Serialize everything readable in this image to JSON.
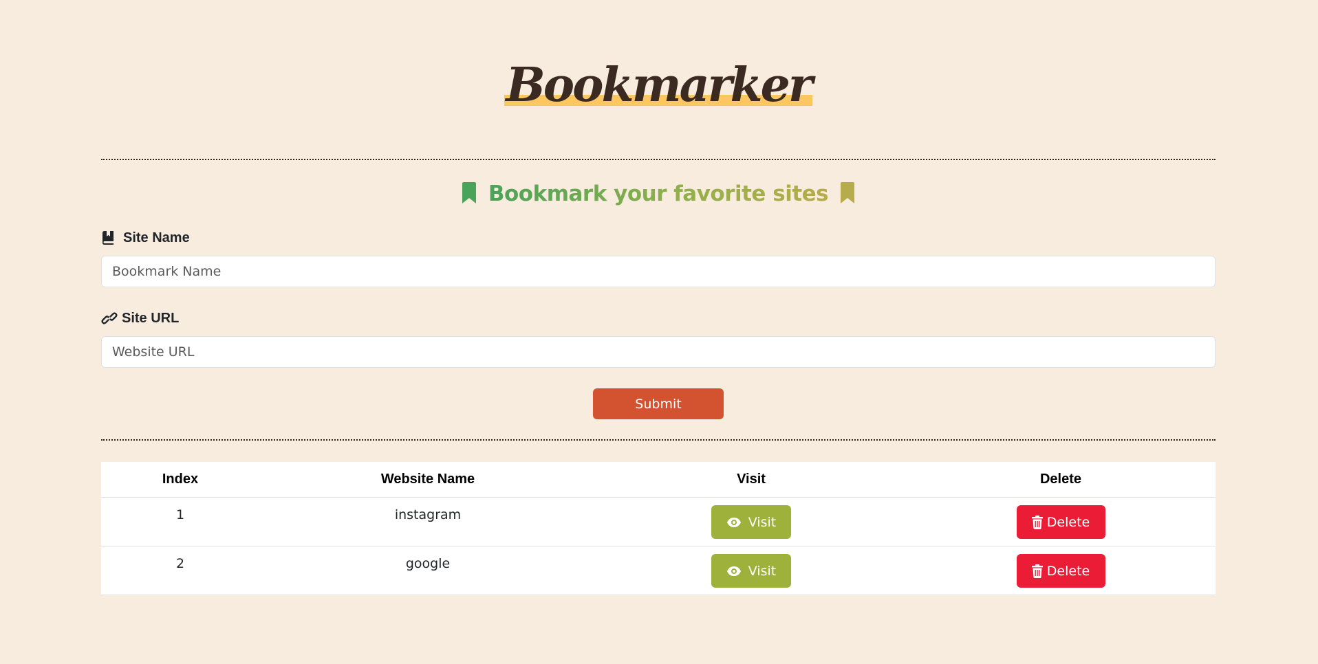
{
  "header": {
    "title": "Bookmarker",
    "subtitle": "Bookmark your favorite sites",
    "colors": {
      "title_highlight": "#fcc760",
      "subtitle_start": "#4aa35a",
      "subtitle_end": "#b6ac4c",
      "background": "#f8ecdf"
    }
  },
  "form": {
    "site_name": {
      "label": "Site Name",
      "icon": "book-bookmark-icon",
      "placeholder": "Bookmark Name",
      "value": ""
    },
    "site_url": {
      "label": "Site URL",
      "icon": "link-icon",
      "placeholder": "Website URL",
      "value": ""
    },
    "submit_label": "Submit",
    "submit_color": "#d35330"
  },
  "table": {
    "headers": [
      "Index",
      "Website Name",
      "Visit",
      "Delete"
    ],
    "rows": [
      {
        "index": "1",
        "name": "instagram",
        "visit_label": "Visit",
        "delete_label": "Delete"
      },
      {
        "index": "2",
        "name": "google",
        "visit_label": "Visit",
        "delete_label": "Delete"
      }
    ],
    "visit_color": "#9eb23b",
    "delete_color": "#eb1d36"
  }
}
